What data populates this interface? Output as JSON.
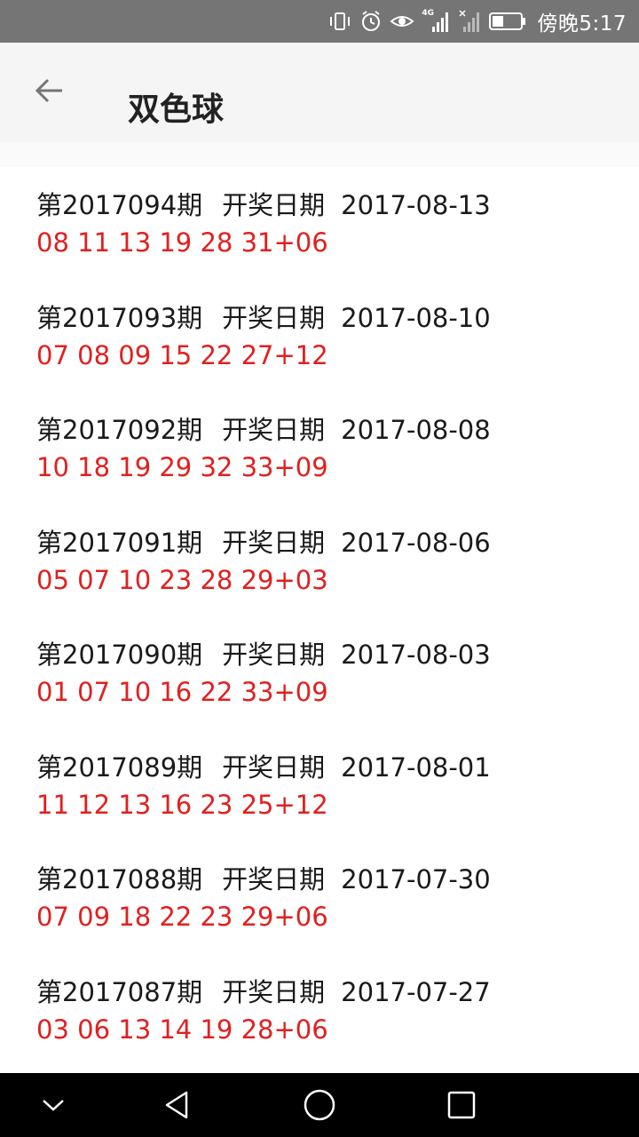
{
  "status_bar": {
    "network": "4G",
    "time": "傍晚5:17",
    "battery_level": 0.4,
    "icons": [
      "vibrate-icon",
      "alarm-icon",
      "eye-comfort-icon",
      "signal-4g-icon",
      "signal-nosim-icon",
      "battery-icon"
    ]
  },
  "app_bar": {
    "title": "双色球",
    "back_icon": "arrow-left-icon"
  },
  "draws": [
    {
      "issue": "第2017094期",
      "date_label": "开奖日期",
      "date": "2017-08-13",
      "numbers": "08 11 13 19 28 31+06"
    },
    {
      "issue": "第2017093期",
      "date_label": "开奖日期",
      "date": "2017-08-10",
      "numbers": "07 08 09 15 22 27+12"
    },
    {
      "issue": "第2017092期",
      "date_label": "开奖日期",
      "date": "2017-08-08",
      "numbers": "10 18 19 29 32 33+09"
    },
    {
      "issue": "第2017091期",
      "date_label": "开奖日期",
      "date": "2017-08-06",
      "numbers": "05 07 10 23 28 29+03"
    },
    {
      "issue": "第2017090期",
      "date_label": "开奖日期",
      "date": "2017-08-03",
      "numbers": "01 07 10 16 22 33+09"
    },
    {
      "issue": "第2017089期",
      "date_label": "开奖日期",
      "date": "2017-08-01",
      "numbers": "11 12 13 16 23 25+12"
    },
    {
      "issue": "第2017088期",
      "date_label": "开奖日期",
      "date": "2017-07-30",
      "numbers": "07 09 18 22 23 29+06"
    },
    {
      "issue": "第2017087期",
      "date_label": "开奖日期",
      "date": "2017-07-27",
      "numbers": "03 06 13 14 19 28+06"
    }
  ],
  "nav_bar": {
    "icons": [
      "collapse-down-icon",
      "back-triangle-icon",
      "home-circle-icon",
      "recents-square-icon"
    ]
  },
  "colors": {
    "numbers": "#e02020",
    "status_bar": "#757575",
    "app_bar": "#f5f5f5",
    "nav_bar": "#000000"
  }
}
